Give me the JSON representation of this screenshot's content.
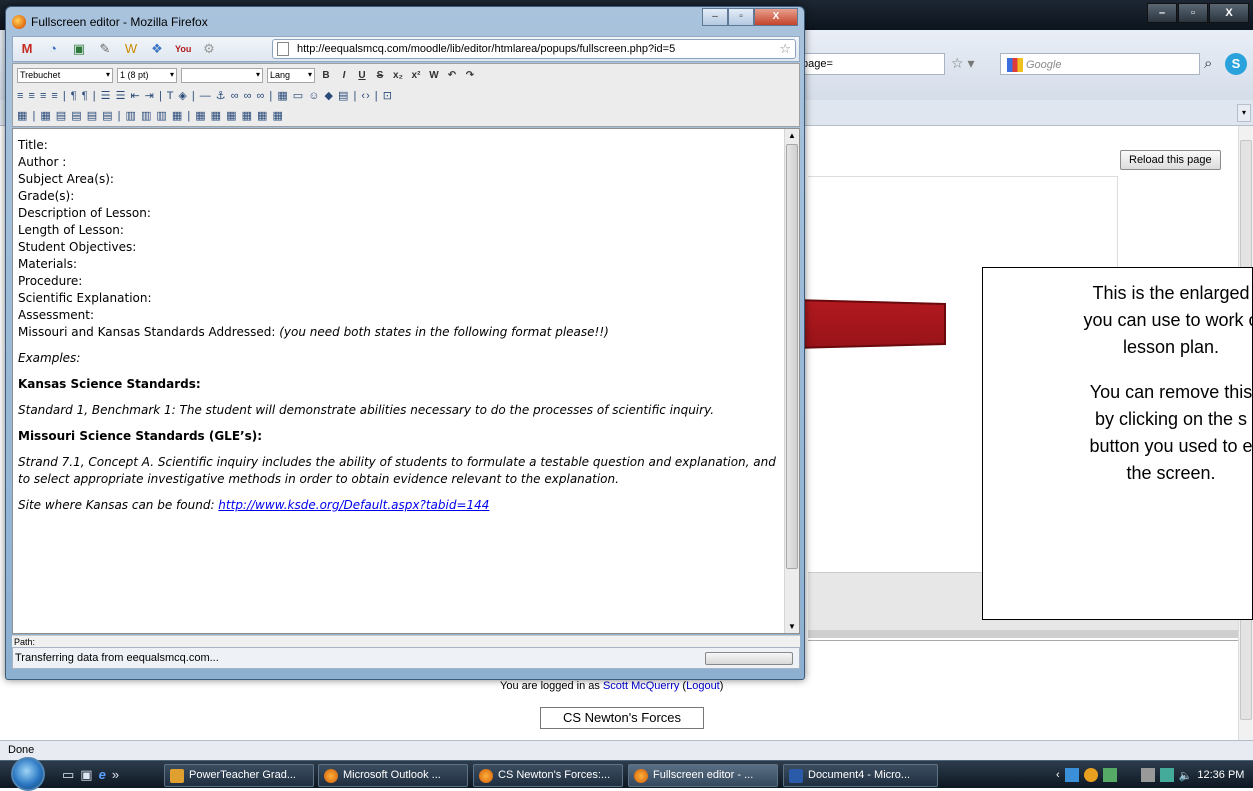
{
  "background_window": {
    "url_partial": "page=",
    "search_placeholder": "Google",
    "reload_label": "Reload this page",
    "logged_in_prefix": "You are logged in as ",
    "user_name": "Scott McQuerry",
    "logout_label": "Logout",
    "course_button": "CS Newton's Forces",
    "status_text": "Done"
  },
  "popup": {
    "title": "Fullscreen editor - Mozilla Firefox",
    "url": "http://eequalsmcq.com/moodle/lib/editor/htmlarea/popups/fullscreen.php?id=5",
    "toolbar": {
      "font_select": "Trebuchet",
      "size_select": "1 (8 pt)",
      "lang_select": "Lang"
    },
    "editor": {
      "fields": [
        "Title:",
        "Author :",
        "Subject Area(s):",
        "Grade(s):",
        "Description of Lesson:",
        "Length of Lesson:",
        "Student Objectives:",
        "Materials:",
        "Procedure:",
        "Scientific Explanation:",
        "Assessment:"
      ],
      "standards_label": "Missouri and Kansas Standards Addressed: ",
      "standards_note": "(you need both states in the following format please!!)",
      "examples": "Examples:",
      "kansas_heading": "Kansas Science Standards:",
      "kansas_text": "Standard 1, Benchmark 1: The student will demonstrate abilities necessary to do the processes of scientific inquiry.",
      "missouri_heading": "Missouri Science Standards (GLE’s):",
      "missouri_text": "Strand 7.1, Concept A. Scientific inquiry includes the ability of students to formulate a testable question and explanation, and to select appropriate investigative methods in order to obtain evidence relevant to the explanation.",
      "site_label": "Site where Kansas can be found: ",
      "site_link": "http://www.ksde.org/Default.aspx?tabid=144"
    },
    "path_label": "Path:",
    "status": "Transferring data from eequalsmcq.com..."
  },
  "callout": {
    "line1": "This is the enlarged",
    "line2": "you can use to work o",
    "line3": "lesson plan.",
    "line4": "You can remove this",
    "line5": "by clicking on the s",
    "line6": "button you used to e",
    "line7": "the screen."
  },
  "taskbar": {
    "items": [
      "PowerTeacher Grad...",
      "Microsoft Outlook ...",
      "CS Newton's Forces:...",
      "Fullscreen editor - ...",
      "Document4 - Micro..."
    ],
    "clock": "12:36 PM"
  },
  "colors": {
    "arrow": "#a31218",
    "link": "#0000ee",
    "taskbar": "#1a2633"
  },
  "icons": [
    "gmail-icon",
    "wrench-icon",
    "youtube-icon",
    "search-icon",
    "page-icon",
    "star-icon",
    "windows-start-icon",
    "firefox-icon"
  ]
}
